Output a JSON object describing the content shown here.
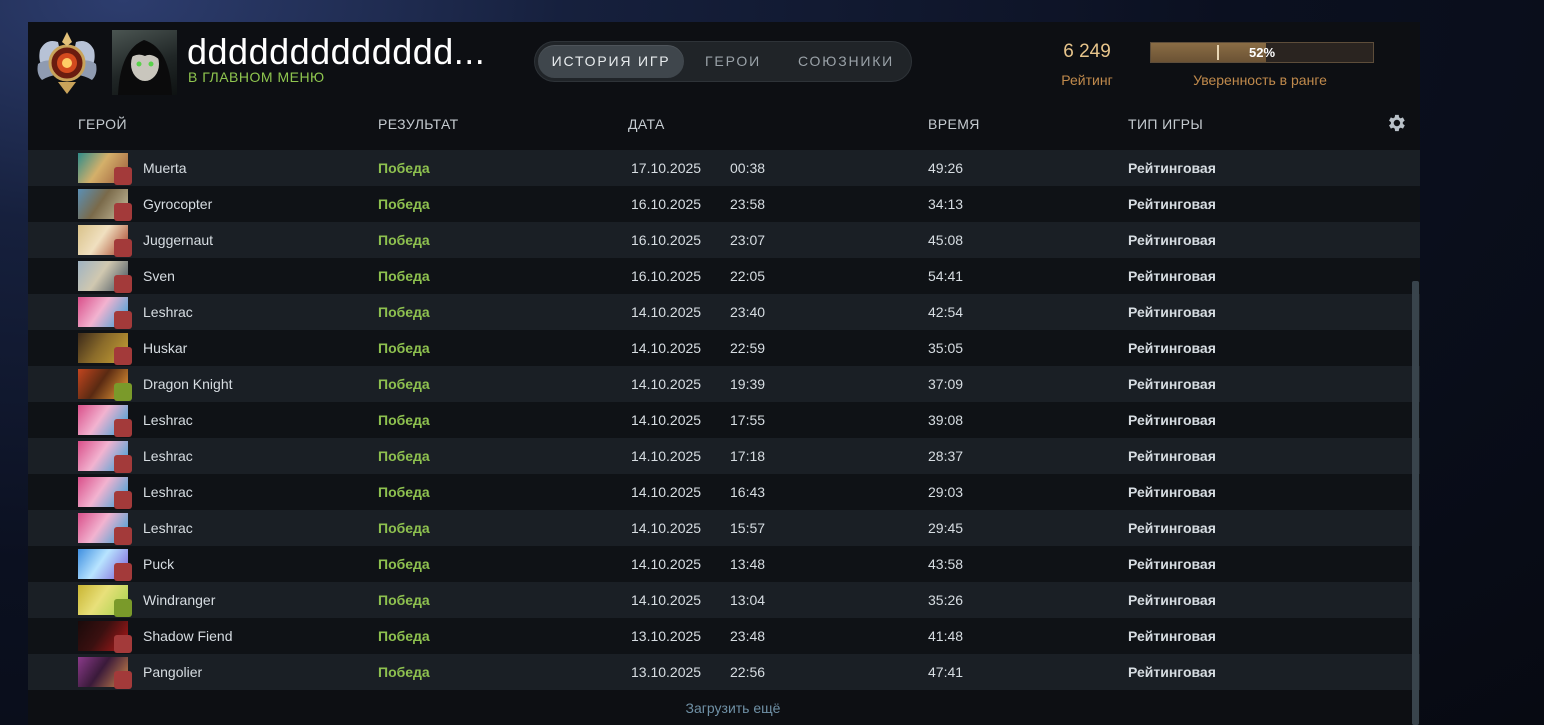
{
  "profile": {
    "name": "ddddddddddddd...",
    "status": "В ГЛАВНОМ МЕНЮ"
  },
  "tabs": [
    {
      "label": "ИСТОРИЯ ИГР",
      "active": true
    },
    {
      "label": "ГЕРОИ",
      "active": false
    },
    {
      "label": "СОЮЗНИКИ",
      "active": false
    }
  ],
  "rating": {
    "value": "6 249",
    "label": "Рейтинг"
  },
  "confidence": {
    "percent_text": "52%",
    "level": 0.52,
    "label": "Уверенность в ранге"
  },
  "columns": {
    "hero": "ГЕРОЙ",
    "result": "РЕЗУЛЬТАТ",
    "date": "ДАТА",
    "duration": "ВРЕМЯ",
    "mode": "ТИП ИГРЫ"
  },
  "matches": [
    {
      "hero": "Muerta",
      "result": "Победа",
      "date": "17.10.2025",
      "time": "00:38",
      "duration": "49:26",
      "mode": "Рейтинговая"
    },
    {
      "hero": "Gyrocopter",
      "result": "Победа",
      "date": "16.10.2025",
      "time": "23:58",
      "duration": "34:13",
      "mode": "Рейтинговая"
    },
    {
      "hero": "Juggernaut",
      "result": "Победа",
      "date": "16.10.2025",
      "time": "23:07",
      "duration": "45:08",
      "mode": "Рейтинговая"
    },
    {
      "hero": "Sven",
      "result": "Победа",
      "date": "16.10.2025",
      "time": "22:05",
      "duration": "54:41",
      "mode": "Рейтинговая"
    },
    {
      "hero": "Leshrac",
      "result": "Победа",
      "date": "14.10.2025",
      "time": "23:40",
      "duration": "42:54",
      "mode": "Рейтинговая"
    },
    {
      "hero": "Huskar",
      "result": "Победа",
      "date": "14.10.2025",
      "time": "22:59",
      "duration": "35:05",
      "mode": "Рейтинговая"
    },
    {
      "hero": "Dragon Knight",
      "result": "Победа",
      "date": "14.10.2025",
      "time": "19:39",
      "duration": "37:09",
      "mode": "Рейтинговая"
    },
    {
      "hero": "Leshrac",
      "result": "Победа",
      "date": "14.10.2025",
      "time": "17:55",
      "duration": "39:08",
      "mode": "Рейтинговая"
    },
    {
      "hero": "Leshrac",
      "result": "Победа",
      "date": "14.10.2025",
      "time": "17:18",
      "duration": "28:37",
      "mode": "Рейтинговая"
    },
    {
      "hero": "Leshrac",
      "result": "Победа",
      "date": "14.10.2025",
      "time": "16:43",
      "duration": "29:03",
      "mode": "Рейтинговая"
    },
    {
      "hero": "Leshrac",
      "result": "Победа",
      "date": "14.10.2025",
      "time": "15:57",
      "duration": "29:45",
      "mode": "Рейтинговая"
    },
    {
      "hero": "Puck",
      "result": "Победа",
      "date": "14.10.2025",
      "time": "13:48",
      "duration": "43:58",
      "mode": "Рейтинговая"
    },
    {
      "hero": "Windranger",
      "result": "Победа",
      "date": "14.10.2025",
      "time": "13:04",
      "duration": "35:26",
      "mode": "Рейтинговая"
    },
    {
      "hero": "Shadow Fiend",
      "result": "Победа",
      "date": "13.10.2025",
      "time": "23:48",
      "duration": "41:48",
      "mode": "Рейтинговая"
    },
    {
      "hero": "Pangolier",
      "result": "Победа",
      "date": "13.10.2025",
      "time": "22:56",
      "duration": "47:41",
      "mode": "Рейтинговая"
    }
  ],
  "load_more": "Загрузить ещё",
  "colors": {
    "win": "#8ec14f",
    "rating": "#e6c48b",
    "accent_label": "#c08a4c",
    "status": "#8fc64f"
  },
  "icons": {
    "rank": "rank-medal-icon",
    "settings": "gear-icon"
  }
}
